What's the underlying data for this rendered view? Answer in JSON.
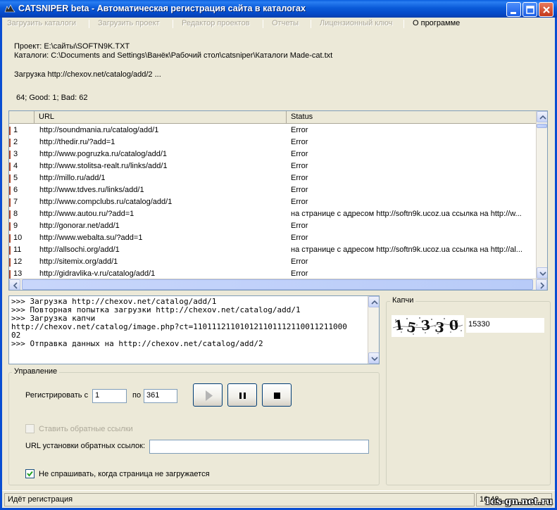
{
  "window": {
    "title": "CATSNIPER beta - Автоматическая регистрация сайта в каталогах"
  },
  "menu": {
    "items": [
      {
        "label": "Загрузить каталоги",
        "enabled": false
      },
      {
        "label": "Загрузить проект",
        "enabled": false
      },
      {
        "label": "Редактор проектов",
        "enabled": false
      },
      {
        "label": "Отчеты",
        "enabled": false
      },
      {
        "label": "Лицензионный ключ",
        "enabled": false
      },
      {
        "label": "О программе",
        "enabled": true
      }
    ]
  },
  "info": {
    "project": "Проект: E:\\сайты\\SOFTN9K.TXT",
    "catalogs": "Каталоги: C:\\Documents and Settings\\Ванёк\\Рабочий стол\\catsniper\\Каталоги Made-cat.txt",
    "loading": "Загрузка http://chexov.net/catalog/add/2 ...",
    "stats": "64; Good: 1; Bad: 62"
  },
  "grid": {
    "columns": [
      "URL",
      "Status"
    ],
    "rows": [
      {
        "n": "1",
        "url": "http://soundmania.ru/catalog/add/1",
        "status": "Error"
      },
      {
        "n": "2",
        "url": "http://thedir.ru/?add=1",
        "status": "Error"
      },
      {
        "n": "3",
        "url": "http://www.pogruzka.ru/catalog/add/1",
        "status": "Error"
      },
      {
        "n": "4",
        "url": "http://www.stolitsa-realt.ru/links/add/1",
        "status": "Error"
      },
      {
        "n": "5",
        "url": "http://millo.ru/add/1",
        "status": "Error"
      },
      {
        "n": "6",
        "url": "http://www.tdves.ru/links/add/1",
        "status": "Error"
      },
      {
        "n": "7",
        "url": "http://www.compclubs.ru/catalog/add/1",
        "status": "Error"
      },
      {
        "n": "8",
        "url": "http://www.autou.ru/?add=1",
        "status": "на странице с адресом  http://softn9k.ucoz.ua  ссылка на  http://w..."
      },
      {
        "n": "9",
        "url": "http://gonorar.net/add/1",
        "status": "Error"
      },
      {
        "n": "10",
        "url": "http://www.webalta.su/?add=1",
        "status": "Error"
      },
      {
        "n": "11",
        "url": "http://allsochi.org/add/1",
        "status": "на странице с адресом  http://softn9k.ucoz.ua  ссылка на  http://al..."
      },
      {
        "n": "12",
        "url": "http://sitemix.org/add/1",
        "status": "Error"
      },
      {
        "n": "13",
        "url": "http://gidravlika-v.ru/catalog/add/1",
        "status": "Error"
      }
    ]
  },
  "log": {
    "lines": [
      ">>> Загрузка http://chexov.net/catalog/add/1",
      ">>> Повторная попытка загрузки http://chexov.net/catalog/add/1",
      ">>> Загрузка капчи",
      "http://chexov.net/catalog/image.php?ct=110111211010121101112110011211000",
      "02",
      ">>> Отправка данных на http://chexov.net/catalog/add/2"
    ]
  },
  "control": {
    "legend": "Управление",
    "register_from_label": "Регистрировать с",
    "from_value": "1",
    "to_label": "по",
    "to_value": "361",
    "backlinks_label": "Ставить обратные ссылки",
    "backlinks_checked": false,
    "backlinks_url_label": "URL установки обратных ссылок:",
    "backlinks_url_value": "",
    "no_ask_label": "Не спрашивать, когда страница не загружается",
    "no_ask_checked": true
  },
  "captcha": {
    "legend": "Капчи",
    "image_text": "15330",
    "value": "15330"
  },
  "status": {
    "text": "Идёт регистрация",
    "time": "16:48"
  },
  "watermark": "1cs-gn.net.ru",
  "colors": {
    "titlebar": "#0a5ad8",
    "window_bg": "#ece9d8",
    "disabled_text": "#aca899",
    "row_marker": "#b0492f"
  }
}
